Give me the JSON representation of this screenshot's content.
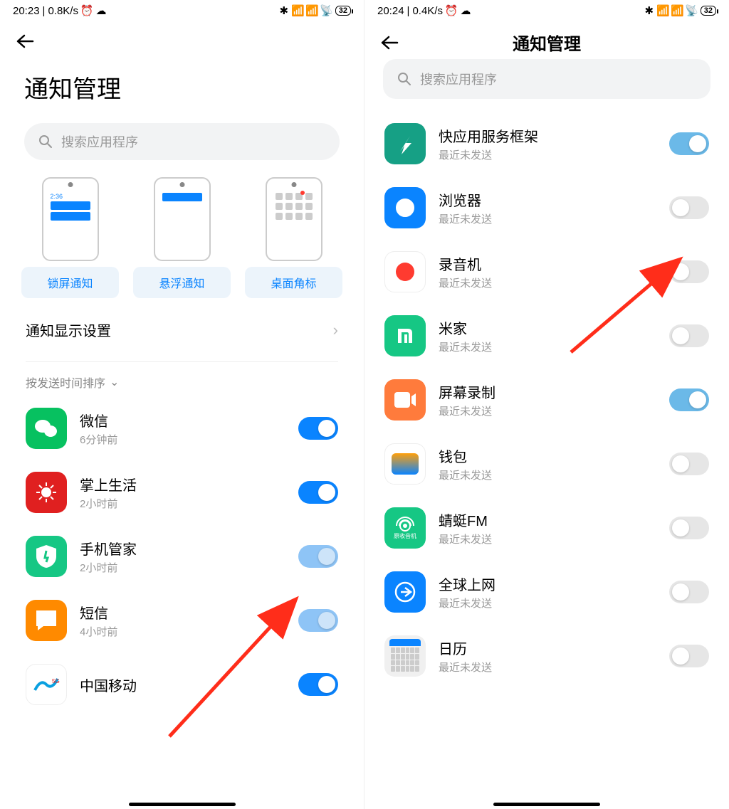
{
  "left": {
    "status": {
      "time": "20:23",
      "net": "0.8K/s",
      "battery": "32"
    },
    "title": "通知管理",
    "search_placeholder": "搜索应用程序",
    "categories": [
      {
        "label": "锁屏通知",
        "time_sample": "2:36"
      },
      {
        "label": "悬浮通知"
      },
      {
        "label": "桌面角标"
      }
    ],
    "setting_display": "通知显示设置",
    "sort_label": "按发送时间排序",
    "apps": [
      {
        "name": "微信",
        "sub": "6分钟前",
        "icon": "wechat",
        "toggle": "on"
      },
      {
        "name": "掌上生活",
        "sub": "2小时前",
        "icon": "life",
        "toggle": "on"
      },
      {
        "name": "手机管家",
        "sub": "2小时前",
        "icon": "guard",
        "toggle": "on-light"
      },
      {
        "name": "短信",
        "sub": "4小时前",
        "icon": "sms",
        "toggle": "on-light"
      },
      {
        "name": "中国移动",
        "sub": "",
        "icon": "cmcc",
        "toggle": "on"
      }
    ]
  },
  "right": {
    "status": {
      "time": "20:24",
      "net": "0.4K/s",
      "battery": "32"
    },
    "title": "通知管理",
    "search_placeholder": "搜索应用程序",
    "apps": [
      {
        "name": "快应用服务框架",
        "sub": "最近未发送",
        "icon": "quick",
        "toggle": "on-teal"
      },
      {
        "name": "浏览器",
        "sub": "最近未发送",
        "icon": "browser",
        "toggle": "off"
      },
      {
        "name": "录音机",
        "sub": "最近未发送",
        "icon": "rec",
        "toggle": "off"
      },
      {
        "name": "米家",
        "sub": "最近未发送",
        "icon": "mi",
        "toggle": "off"
      },
      {
        "name": "屏幕录制",
        "sub": "最近未发送",
        "icon": "screen",
        "toggle": "on-teal"
      },
      {
        "name": "钱包",
        "sub": "最近未发送",
        "icon": "wallet",
        "toggle": "off"
      },
      {
        "name": "蜻蜓FM",
        "sub": "最近未发送",
        "icon": "fm",
        "toggle": "off"
      },
      {
        "name": "全球上网",
        "sub": "最近未发送",
        "icon": "net",
        "toggle": "off"
      },
      {
        "name": "日历",
        "sub": "最近未发送",
        "icon": "cal",
        "toggle": "off"
      }
    ]
  }
}
